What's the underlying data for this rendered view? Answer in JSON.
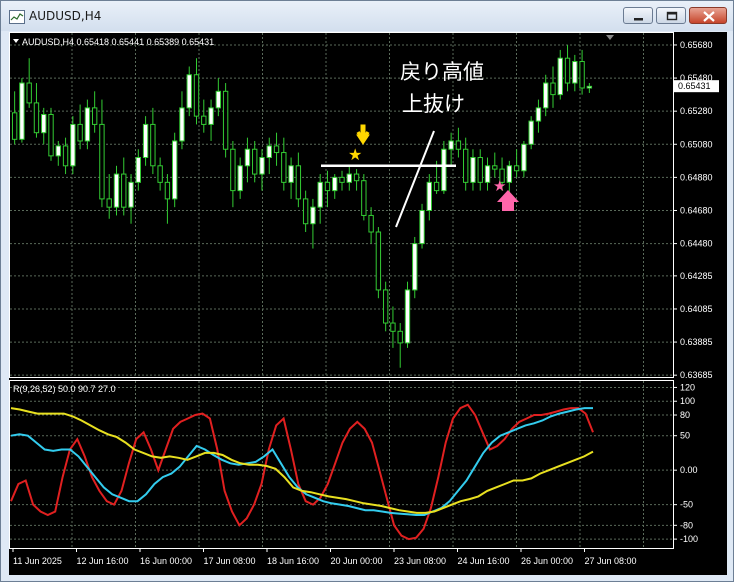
{
  "window": {
    "title": "AUDUSD,H4",
    "controls": [
      "minimize-icon",
      "maximize-icon",
      "close-icon"
    ]
  },
  "chart_header": {
    "text": "AUDUSD,H4  0.65418 0.65441 0.65389 0.65431"
  },
  "price_axis": {
    "ticks": [
      "0.65680",
      "0.65480",
      "0.65280",
      "0.65080",
      "0.64880",
      "0.64680",
      "0.64480",
      "0.64285",
      "0.64085",
      "0.63885",
      "0.63685"
    ],
    "current_price": "0.65431"
  },
  "annotations": {
    "line1": "戻り高値",
    "line2": "上抜け"
  },
  "indicator": {
    "label": "R(9,26,52) 50.0 90.7 27.0",
    "ticks": [
      "120",
      "100",
      "80",
      "50",
      "0.00",
      "-50",
      "-80",
      "-100"
    ]
  },
  "time_axis": {
    "labels": [
      "11 Jun 2025",
      "12 Jun 16:00",
      "16 Jun 00:00",
      "17 Jun 08:00",
      "18 Jun 16:00",
      "20 Jun 00:00",
      "23 Jun 08:00",
      "24 Jun 16:00",
      "26 Jun 00:00",
      "27 Jun 08:00"
    ]
  },
  "colors": {
    "background": "#000000",
    "bull_candle": "#ffffff",
    "bear_candle": "#000000",
    "wick": "#33cc33",
    "grid": "#5a6a5a",
    "red_line": "#e02020",
    "cyan_line": "#33ccee",
    "yellow_line": "#e8e020",
    "yellow_marker": "#ffd700",
    "pink_marker": "#ff66aa"
  },
  "chart_data": {
    "type": "candlestick",
    "symbol": "AUDUSD",
    "timeframe": "H4",
    "ylim": [
      0.6368,
      0.6571
    ],
    "ohlc": [
      [
        0.6527,
        0.654,
        0.6508,
        0.6511
      ],
      [
        0.6511,
        0.6548,
        0.6509,
        0.6545
      ],
      [
        0.6545,
        0.656,
        0.653,
        0.6533
      ],
      [
        0.6533,
        0.6545,
        0.6512,
        0.6515
      ],
      [
        0.6515,
        0.653,
        0.6508,
        0.6526
      ],
      [
        0.6526,
        0.653,
        0.6498,
        0.6501
      ],
      [
        0.6501,
        0.651,
        0.6495,
        0.6507
      ],
      [
        0.6507,
        0.6512,
        0.649,
        0.6495
      ],
      [
        0.6495,
        0.6525,
        0.649,
        0.652
      ],
      [
        0.652,
        0.6532,
        0.6505,
        0.651
      ],
      [
        0.651,
        0.6535,
        0.6505,
        0.653
      ],
      [
        0.653,
        0.654,
        0.6515,
        0.652
      ],
      [
        0.652,
        0.6535,
        0.647,
        0.6475
      ],
      [
        0.6475,
        0.649,
        0.6463,
        0.647
      ],
      [
        0.647,
        0.6495,
        0.6465,
        0.649
      ],
      [
        0.649,
        0.65,
        0.6465,
        0.647
      ],
      [
        0.647,
        0.649,
        0.646,
        0.6485
      ],
      [
        0.6485,
        0.6505,
        0.648,
        0.65
      ],
      [
        0.65,
        0.6525,
        0.6495,
        0.652
      ],
      [
        0.652,
        0.653,
        0.649,
        0.6495
      ],
      [
        0.6495,
        0.65,
        0.648,
        0.6485
      ],
      [
        0.6485,
        0.649,
        0.646,
        0.6475
      ],
      [
        0.6475,
        0.6515,
        0.647,
        0.651
      ],
      [
        0.651,
        0.654,
        0.6505,
        0.653
      ],
      [
        0.653,
        0.6555,
        0.6525,
        0.655
      ],
      [
        0.655,
        0.656,
        0.652,
        0.6525
      ],
      [
        0.6525,
        0.6535,
        0.6515,
        0.652
      ],
      [
        0.652,
        0.6535,
        0.651,
        0.653
      ],
      [
        0.653,
        0.6548,
        0.6525,
        0.654
      ],
      [
        0.654,
        0.6545,
        0.65,
        0.6505
      ],
      [
        0.6505,
        0.651,
        0.647,
        0.648
      ],
      [
        0.648,
        0.65,
        0.6475,
        0.6495
      ],
      [
        0.6495,
        0.6512,
        0.6485,
        0.6505
      ],
      [
        0.6505,
        0.651,
        0.6485,
        0.649
      ],
      [
        0.649,
        0.6505,
        0.648,
        0.65
      ],
      [
        0.65,
        0.6512,
        0.649,
        0.6507
      ],
      [
        0.6507,
        0.6515,
        0.6495,
        0.6503
      ],
      [
        0.6503,
        0.6512,
        0.648,
        0.6485
      ],
      [
        0.6485,
        0.65,
        0.6475,
        0.6495
      ],
      [
        0.6495,
        0.6503,
        0.647,
        0.6475
      ],
      [
        0.6475,
        0.648,
        0.6455,
        0.646
      ],
      [
        0.646,
        0.6475,
        0.6445,
        0.647
      ],
      [
        0.647,
        0.649,
        0.646,
        0.6485
      ],
      [
        0.6485,
        0.6492,
        0.647,
        0.648
      ],
      [
        0.648,
        0.649,
        0.6475,
        0.6488
      ],
      [
        0.6488,
        0.6492,
        0.648,
        0.6485
      ],
      [
        0.6485,
        0.6495,
        0.648,
        0.649
      ],
      [
        0.649,
        0.6493,
        0.648,
        0.6486
      ],
      [
        0.6486,
        0.649,
        0.6462,
        0.6465
      ],
      [
        0.6465,
        0.647,
        0.6448,
        0.6455
      ],
      [
        0.6455,
        0.6458,
        0.6415,
        0.642
      ],
      [
        0.642,
        0.6425,
        0.6395,
        0.64
      ],
      [
        0.64,
        0.641,
        0.6385,
        0.6395
      ],
      [
        0.6395,
        0.64,
        0.6373,
        0.6388
      ],
      [
        0.6388,
        0.6425,
        0.6385,
        0.642
      ],
      [
        0.642,
        0.6452,
        0.6415,
        0.6448
      ],
      [
        0.6448,
        0.6472,
        0.6445,
        0.6468
      ],
      [
        0.6468,
        0.649,
        0.6462,
        0.6485
      ],
      [
        0.6485,
        0.6498,
        0.6478,
        0.648
      ],
      [
        0.648,
        0.651,
        0.6478,
        0.6505
      ],
      [
        0.6505,
        0.6515,
        0.6495,
        0.651
      ],
      [
        0.651,
        0.6518,
        0.65,
        0.6505
      ],
      [
        0.6505,
        0.6512,
        0.648,
        0.6485
      ],
      [
        0.6485,
        0.6505,
        0.648,
        0.65
      ],
      [
        0.65,
        0.6505,
        0.648,
        0.6485
      ],
      [
        0.6485,
        0.65,
        0.648,
        0.6495
      ],
      [
        0.6495,
        0.6503,
        0.6488,
        0.6493
      ],
      [
        0.6493,
        0.65,
        0.648,
        0.6485
      ],
      [
        0.6485,
        0.6498,
        0.6478,
        0.6495
      ],
      [
        0.6495,
        0.6505,
        0.6488,
        0.6492
      ],
      [
        0.6492,
        0.651,
        0.6488,
        0.6508
      ],
      [
        0.6508,
        0.6525,
        0.6505,
        0.6522
      ],
      [
        0.6522,
        0.6535,
        0.6515,
        0.653
      ],
      [
        0.653,
        0.655,
        0.6525,
        0.6545
      ],
      [
        0.6545,
        0.6555,
        0.653,
        0.6538
      ],
      [
        0.6538,
        0.6565,
        0.6535,
        0.656
      ],
      [
        0.656,
        0.6568,
        0.654,
        0.6545
      ],
      [
        0.6545,
        0.6562,
        0.654,
        0.6558
      ],
      [
        0.6558,
        0.6565,
        0.6538,
        0.6542
      ],
      [
        0.6542,
        0.6545,
        0.6539,
        0.6543
      ]
    ],
    "resistance_line": 0.6495,
    "markers": [
      {
        "type": "star",
        "color": "yellow",
        "index": 45,
        "price": 0.6502
      },
      {
        "type": "arrow-down",
        "color": "yellow",
        "index": 46,
        "price": 0.6508
      },
      {
        "type": "star",
        "color": "pink",
        "index": 70,
        "price": 0.6484
      },
      {
        "type": "arrow-up",
        "color": "pink",
        "index": 70,
        "price": 0.6474
      }
    ],
    "oscillator": {
      "label": "R(9,26,52)",
      "ylim": [
        -110,
        125
      ],
      "levels": [
        100,
        80,
        50,
        0,
        -50,
        -80,
        -100
      ],
      "series": [
        {
          "name": "R9",
          "color": "red",
          "values": [
            -45,
            -20,
            -15,
            -50,
            -60,
            -65,
            -60,
            -10,
            30,
            45,
            20,
            -10,
            -30,
            -45,
            -50,
            -30,
            10,
            45,
            55,
            30,
            0,
            30,
            60,
            70,
            75,
            80,
            82,
            75,
            30,
            -30,
            -60,
            -80,
            -70,
            -50,
            -20,
            30,
            65,
            75,
            30,
            -20,
            -45,
            -50,
            -40,
            -20,
            10,
            40,
            60,
            70,
            60,
            40,
            0,
            -40,
            -80,
            -95,
            -100,
            -98,
            -85,
            -55,
            -10,
            40,
            75,
            90,
            95,
            80,
            55,
            30,
            35,
            45,
            60,
            70,
            75,
            80,
            80,
            82,
            85,
            88,
            90,
            90,
            82,
            55
          ]
        },
        {
          "name": "R26",
          "color": "cyan",
          "values": [
            50,
            52,
            50,
            40,
            30,
            28,
            30,
            30,
            20,
            5,
            -10,
            -25,
            -35,
            -40,
            -45,
            -45,
            -35,
            -20,
            -10,
            -5,
            5,
            20,
            35,
            30,
            22,
            15,
            10,
            8,
            10,
            12,
            20,
            30,
            10,
            -10,
            -25,
            -35,
            -40,
            -45,
            -48,
            -50,
            -52,
            -55,
            -58,
            -58,
            -60,
            -62,
            -63,
            -64,
            -65,
            -65,
            -60,
            -55,
            -45,
            -30,
            -15,
            5,
            25,
            40,
            50,
            55,
            60,
            65,
            68,
            72,
            78,
            82,
            85,
            88,
            90,
            90
          ]
        },
        {
          "name": "R52",
          "color": "yellow",
          "values": [
            90,
            88,
            85,
            82,
            82,
            82,
            82,
            78,
            72,
            65,
            58,
            52,
            48,
            40,
            30,
            25,
            20,
            18,
            20,
            18,
            15,
            20,
            25,
            25,
            22,
            15,
            10,
            8,
            8,
            6,
            2,
            -10,
            -25,
            -30,
            -32,
            -35,
            -38,
            -40,
            -42,
            -45,
            -48,
            -50,
            -52,
            -55,
            -58,
            -60,
            -62,
            -62,
            -60,
            -55,
            -50,
            -45,
            -42,
            -38,
            -30,
            -25,
            -20,
            -15,
            -15,
            -12,
            -5,
            0,
            5,
            10,
            15,
            20,
            27
          ]
        }
      ]
    }
  }
}
